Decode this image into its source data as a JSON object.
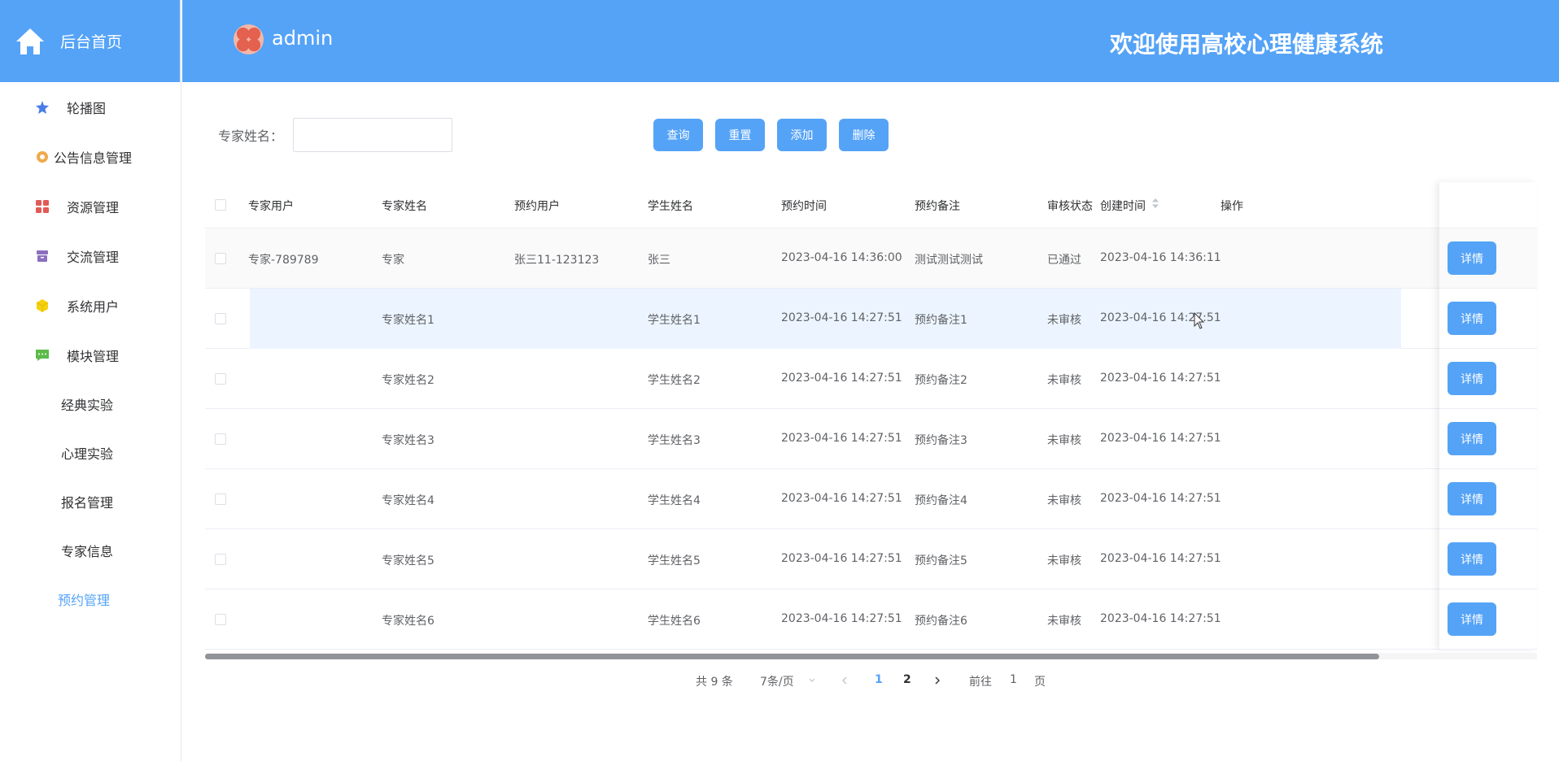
{
  "sidebar": {
    "home_label": "后台首页",
    "items": [
      {
        "label": "轮播图",
        "icon": "star-icon",
        "color": "#4a7de6"
      },
      {
        "label": "公告信息管理",
        "icon": "gear-flower-icon",
        "color": "#f0a94a"
      },
      {
        "label": "资源管理",
        "icon": "blocks-icon",
        "color": "#e25a56"
      },
      {
        "label": "交流管理",
        "icon": "archive-icon",
        "color": "#8b6fbf"
      },
      {
        "label": "系统用户",
        "icon": "cube-icon",
        "color": "#f5d20d"
      },
      {
        "label": "模块管理",
        "icon": "chat-icon",
        "color": "#5dbb4a"
      }
    ],
    "sub_items": [
      "经典实验",
      "心理实验",
      "报名管理",
      "专家信息",
      "预约管理"
    ],
    "active_sub": "预约管理"
  },
  "header": {
    "username": "admin",
    "welcome": "欢迎使用高校心理健康系统"
  },
  "search": {
    "label": "专家姓名：",
    "value": "",
    "placeholder": ""
  },
  "toolbar": {
    "query": "查询",
    "reset": "重置",
    "add": "添加",
    "delete": "删除"
  },
  "table": {
    "columns": [
      "专家用户",
      "专家姓名",
      "预约用户",
      "学生姓名",
      "预约时间",
      "预约备注",
      "审核状态",
      "创建时间",
      "操作"
    ],
    "detail_label": "详情",
    "rows": [
      [
        "专家-789789",
        "专家",
        "张三11-123123",
        "张三",
        "2023-04-16 14:36:00",
        "测试测试测试",
        "已通过",
        "2023-04-16 14:36:11"
      ],
      [
        "",
        "专家姓名1",
        "",
        "学生姓名1",
        "2023-04-16 14:27:51",
        "预约备注1",
        "未审核",
        "2023-04-16 14:27:51"
      ],
      [
        "",
        "专家姓名2",
        "",
        "学生姓名2",
        "2023-04-16 14:27:51",
        "预约备注2",
        "未审核",
        "2023-04-16 14:27:51"
      ],
      [
        "",
        "专家姓名3",
        "",
        "学生姓名3",
        "2023-04-16 14:27:51",
        "预约备注3",
        "未审核",
        "2023-04-16 14:27:51"
      ],
      [
        "",
        "专家姓名4",
        "",
        "学生姓名4",
        "2023-04-16 14:27:51",
        "预约备注4",
        "未审核",
        "2023-04-16 14:27:51"
      ],
      [
        "",
        "专家姓名5",
        "",
        "学生姓名5",
        "2023-04-16 14:27:51",
        "预约备注5",
        "未审核",
        "2023-04-16 14:27:51"
      ],
      [
        "",
        "专家姓名6",
        "",
        "学生姓名6",
        "2023-04-16 14:27:51",
        "预约备注6",
        "未审核",
        "2023-04-16 14:27:51"
      ]
    ]
  },
  "pagination": {
    "total": "共 9 条",
    "page_size": "7条/页",
    "pages": [
      "1",
      "2"
    ],
    "current": "1",
    "goto_prefix": "前往",
    "goto_value": "1",
    "goto_suffix": "页"
  },
  "colors": {
    "primary": "#55a3f7",
    "active_text": "#55a3f7"
  }
}
